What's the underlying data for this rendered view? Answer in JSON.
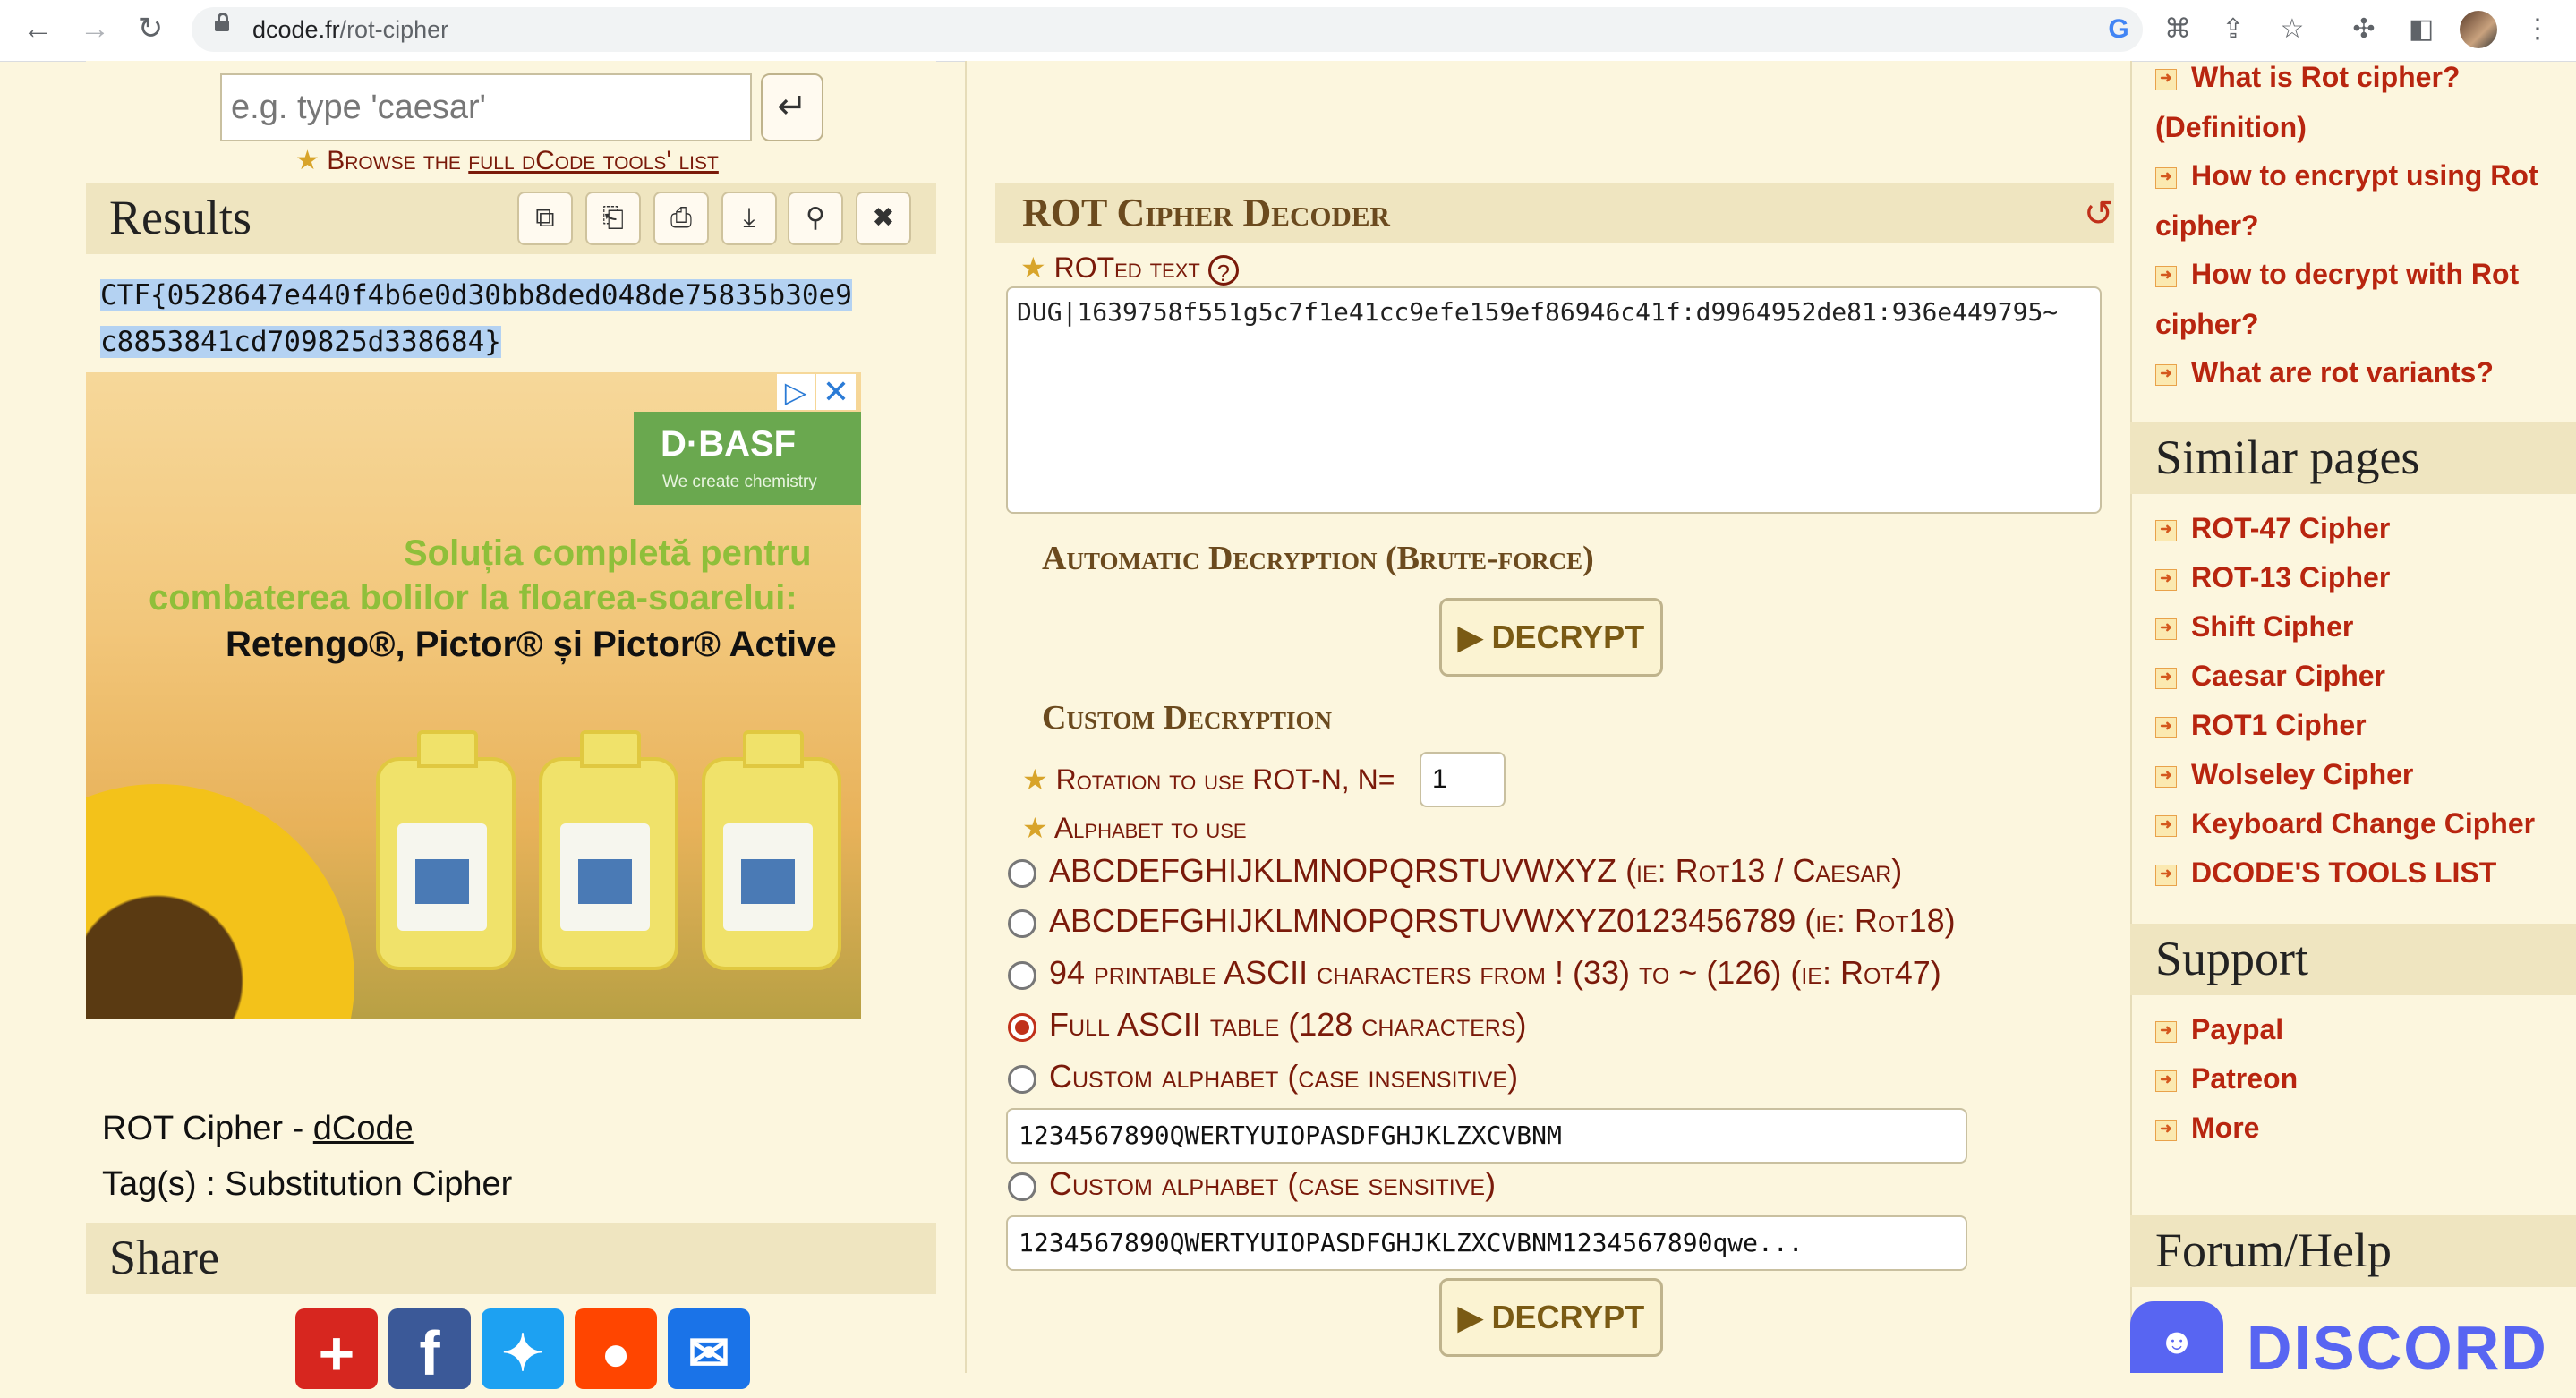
{
  "browser": {
    "url_host": "dcode.fr",
    "url_path": "/rot-cipher"
  },
  "left": {
    "search_placeholder": "e.g. type 'caesar'",
    "browse_prefix": "Browse the ",
    "browse_link": "full dCode tools' list",
    "results_title": "Results",
    "result_line1": "CTF{0528647e440f4b6e0d30bb8ded048de75835b30e9",
    "result_line2": "c8853841cd709825d338684}",
    "ad": {
      "brand": "D·BASF",
      "tagline": "We create chemistry",
      "line1": "Soluția completă pentru",
      "line2": "combaterea bolilor la floarea-soarelui:",
      "line3": "Retengo®, Pictor® și Pictor® Active"
    },
    "page_name": "ROT Cipher - ",
    "page_link": "dCode",
    "tags": "Tag(s) : Substitution Cipher",
    "share_title": "Share"
  },
  "decoder": {
    "title": "ROT Cipher Decoder",
    "roted_label": "ROTed text",
    "input_text": "DUG|1639758f551g5c7f1e41cc9efe159ef86946c41f:d9964952de81:936e449795~",
    "auto_title": "Automatic Decryption (Brute-force)",
    "decrypt_label": "DECRYPT",
    "custom_title": "Custom Decryption",
    "rotation_label": "Rotation to use ROT-N, N=",
    "rotation_value": "1",
    "alphabet_label": "Alphabet to use",
    "options": [
      "ABCDEFGHIJKLMNOPQRSTUVWXYZ (ie: Rot13 / Caesar)",
      "ABCDEFGHIJKLMNOPQRSTUVWXYZ0123456789 (ie: Rot18)",
      "94 printable ASCII characters from ! (33) to ~ (126) (ie: Rot47)",
      "Full ASCII table (128 characters)",
      "Custom alphabet (case insensitive)",
      "Custom alphabet (case sensitive)"
    ],
    "custom_insensitive_value": "1234567890QWERTYUIOPASDFGHJKLZXCVBNM",
    "custom_sensitive_value": "1234567890QWERTYUIOPASDFGHJKLZXCVBNM1234567890qwe..."
  },
  "right": {
    "faq": [
      {
        "l1": "What is Rot cipher?",
        "l2": "(Definition)"
      },
      {
        "l1": "How to encrypt using Rot",
        "l2": "cipher?"
      },
      {
        "l1": "How to decrypt with Rot",
        "l2": "cipher?"
      },
      {
        "l1": "What are rot variants?",
        "l2": ""
      }
    ],
    "similar_title": "Similar pages",
    "similar": [
      "ROT-47 Cipher",
      "ROT-13 Cipher",
      "Shift Cipher",
      "Caesar Cipher",
      "ROT1 Cipher",
      "Wolseley Cipher",
      "Keyboard Change Cipher",
      "DCODE'S TOOLS LIST"
    ],
    "support_title": "Support",
    "support": [
      "Paypal",
      "Patreon",
      "More"
    ],
    "forum_title": "Forum/Help",
    "discord": "DISCORD"
  }
}
